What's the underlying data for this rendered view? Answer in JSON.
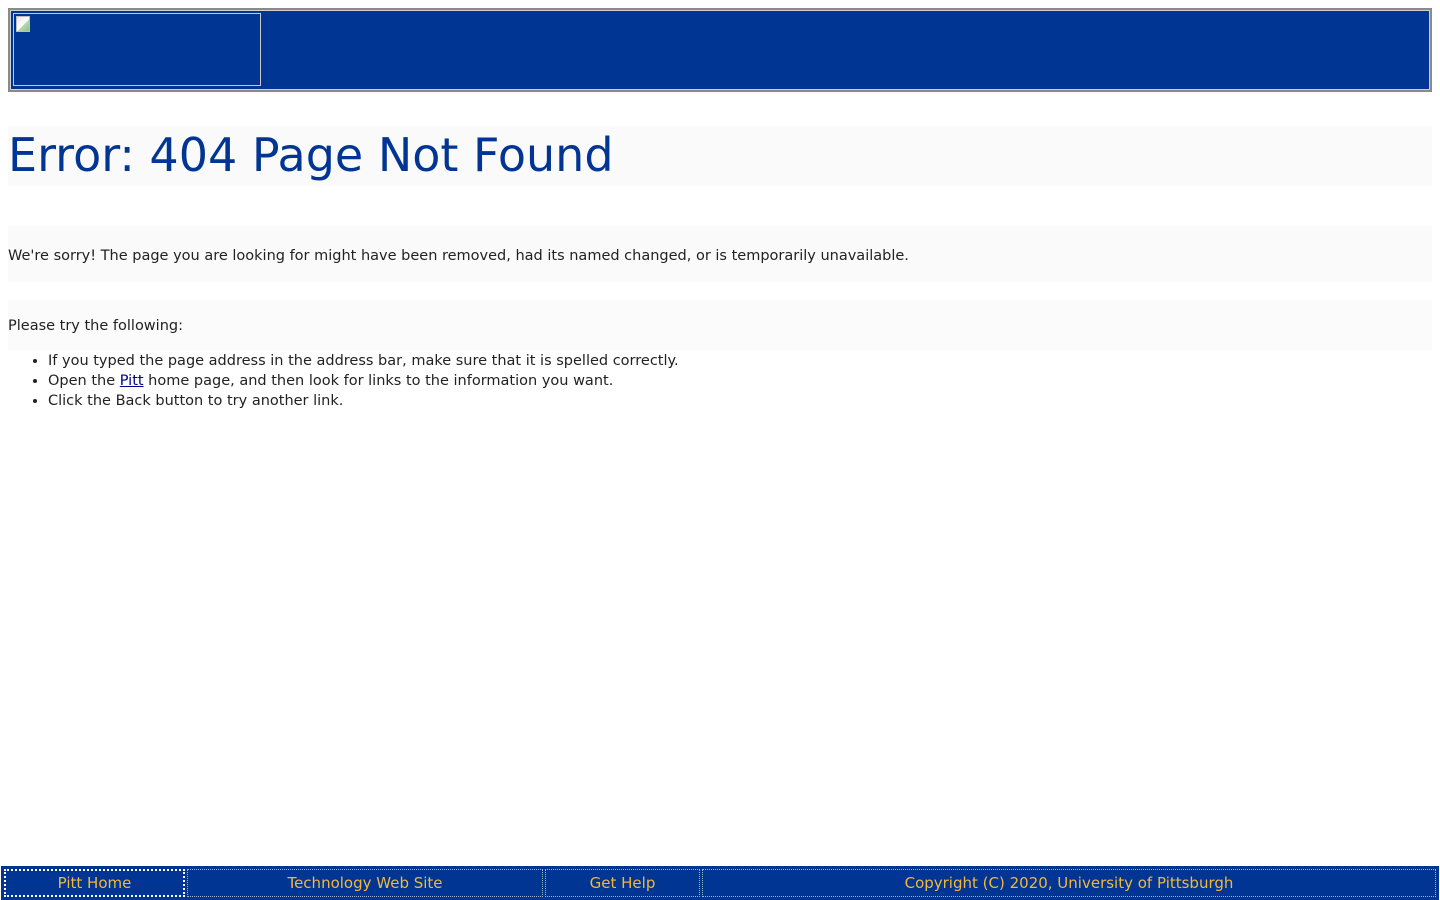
{
  "header": {
    "logo_alt": "",
    "background_color": "#003594"
  },
  "main": {
    "title": "Error: 404 Page Not Found",
    "sorry_text": "We're sorry! The page you are looking for might have been removed, had its named changed, or is temporarily unavailable.",
    "try_label": "Please try the following:",
    "suggestions": {
      "item1": "If you typed the page address in the address bar, make sure that it is spelled correctly.",
      "item2_prefix": "Open the ",
      "item2_link": "Pitt",
      "item2_suffix": " home page, and then look for links to the information you want.",
      "item3": "Click the Back button to try another link."
    },
    "title_color": "#003594"
  },
  "footer": {
    "links": [
      {
        "label": "Pitt Home"
      },
      {
        "label": "Technology Web Site"
      },
      {
        "label": "Get Help"
      }
    ],
    "copyright": "Copyright (C) 2020, University of Pittsburgh",
    "text_color": "#f2b83a",
    "background_color": "#003594"
  }
}
